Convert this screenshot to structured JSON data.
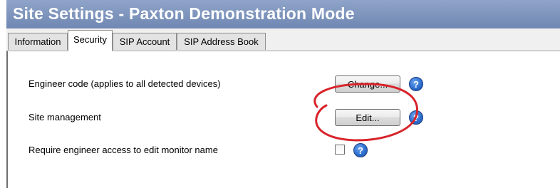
{
  "window": {
    "title": "Site Settings - Paxton Demonstration Mode"
  },
  "tabs": [
    {
      "label": "Information",
      "active": false
    },
    {
      "label": "Security",
      "active": true
    },
    {
      "label": "SIP Account",
      "active": false
    },
    {
      "label": "SIP Address Book",
      "active": false
    }
  ],
  "security": {
    "engineer_code": {
      "label": "Engineer code (applies to all detected devices)",
      "button_label": "Change...",
      "help_icon": "?"
    },
    "site_management": {
      "label": "Site management",
      "button_label": "Edit...",
      "help_icon": "?"
    },
    "require_engineer_access": {
      "label": "Require engineer access to edit monitor name",
      "checked": false,
      "help_icon": "?"
    }
  },
  "annotation": {
    "shape": "ellipse",
    "color": "#d8232a",
    "target": "site-management-edit-button"
  },
  "colors": {
    "title_bar": "#7d94bc",
    "help_icon": "#2d6fd0"
  }
}
